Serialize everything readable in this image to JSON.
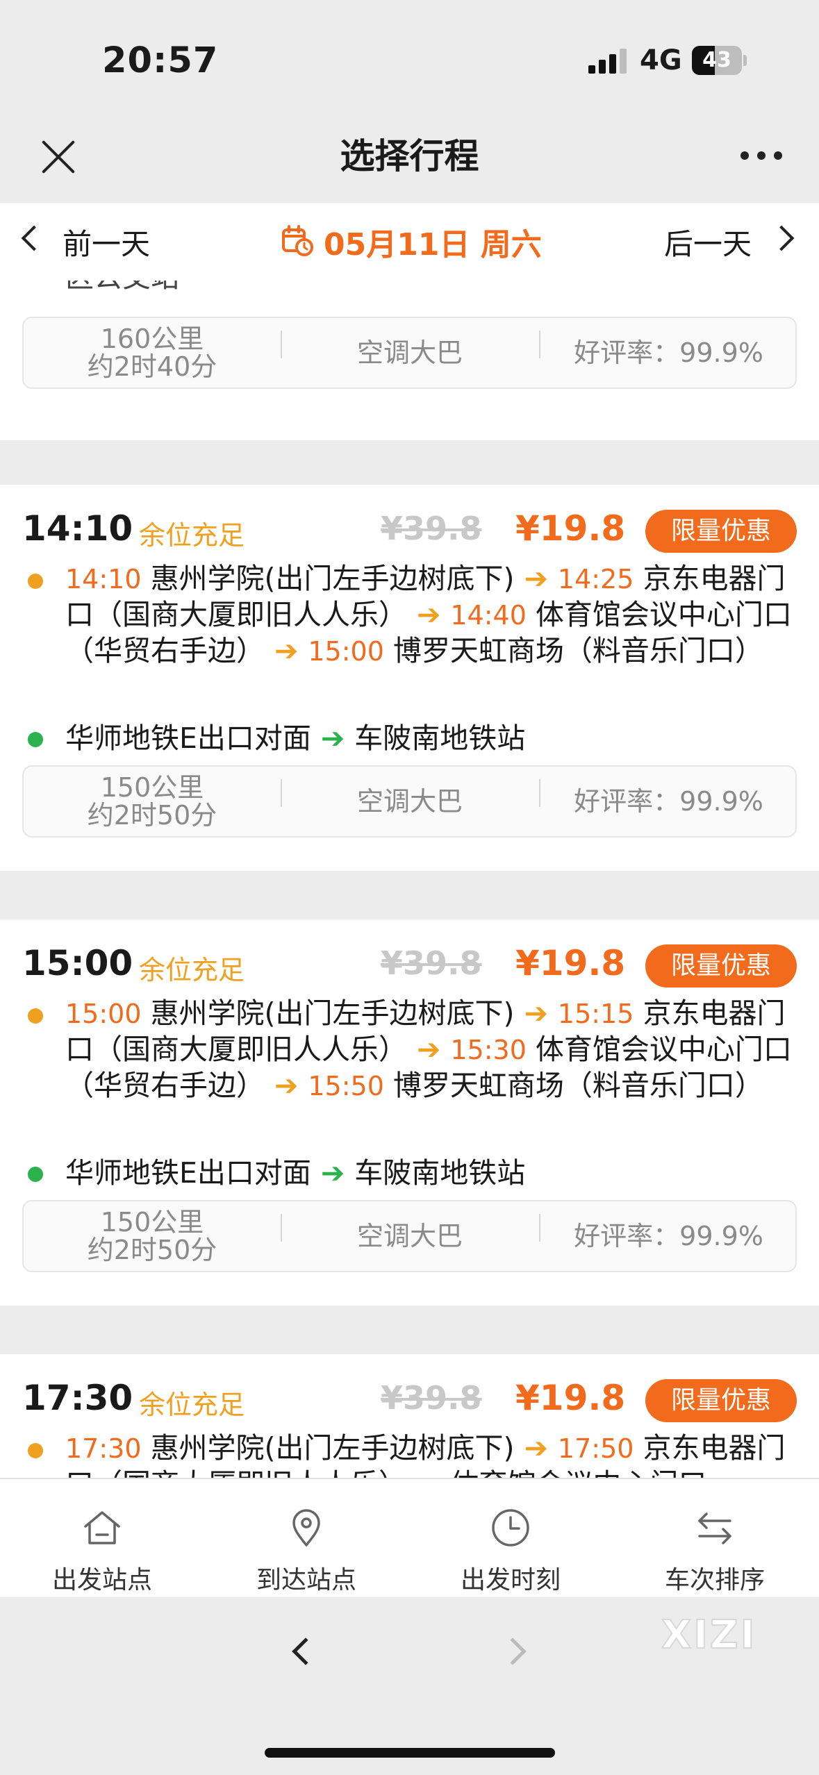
{
  "status": {
    "time": "20:57",
    "network": "4G",
    "battery": "43"
  },
  "nav": {
    "title": "选择行程",
    "close_icon": "close-icon",
    "more_icon": "more-icon"
  },
  "date_bar": {
    "prev": "前一天",
    "date": "05月11日 周六",
    "next": "后一天",
    "icon": "calendar-icon"
  },
  "partial_top": {
    "cut_text": "区公交站",
    "info": {
      "distance": "160公里",
      "duration": "约2时40分",
      "bus": "空调大巴",
      "rating": "好评率：99.9%"
    }
  },
  "trips": [
    {
      "time": "14:10",
      "seat": "余位充足",
      "old_price": "¥39.8",
      "price": "¥19.8",
      "promo": "限量优惠",
      "stops": [
        {
          "t": "14:10",
          "name": "惠州学院(出门左手边树底下)"
        },
        {
          "t": "14:25",
          "name": "京东电器门口（国商大厦即旧人人乐）"
        },
        {
          "t": "14:40",
          "name": "体育馆会议中心门口（华贸右手边）"
        },
        {
          "t": "15:00",
          "name": "博罗天虹商场（料音乐门口）"
        }
      ],
      "from": "华师地铁E出口对面",
      "to": "车陂南地铁站",
      "info": {
        "distance": "150公里",
        "duration": "约2时50分",
        "bus": "空调大巴",
        "rating": "好评率：99.9%"
      }
    },
    {
      "time": "15:00",
      "seat": "余位充足",
      "old_price": "¥39.8",
      "price": "¥19.8",
      "promo": "限量优惠",
      "stops": [
        {
          "t": "15:00",
          "name": "惠州学院(出门左手边树底下)"
        },
        {
          "t": "15:15",
          "name": "京东电器门口（国商大厦即旧人人乐）"
        },
        {
          "t": "15:30",
          "name": "体育馆会议中心门口（华贸右手边）"
        },
        {
          "t": "15:50",
          "name": "博罗天虹商场（料音乐门口）"
        }
      ],
      "from": "华师地铁E出口对面",
      "to": "车陂南地铁站",
      "info": {
        "distance": "150公里",
        "duration": "约2时50分",
        "bus": "空调大巴",
        "rating": "好评率：99.9%"
      }
    },
    {
      "time": "17:30",
      "seat": "余位充足",
      "old_price": "¥39.8",
      "price": "¥19.8",
      "promo": "限量优惠",
      "stops": [
        {
          "t": "17:30",
          "name": "惠州学院(出门左手边树底下)"
        },
        {
          "t": "17:50",
          "name": "京东电器门口（国商大厦即旧人人乐）"
        },
        {
          "t": "",
          "name": "体育馆会议中心门口"
        }
      ]
    }
  ],
  "tabs": [
    {
      "label": "出发站点",
      "icon": "home-icon"
    },
    {
      "label": "到达站点",
      "icon": "location-pin-icon"
    },
    {
      "label": "出发时刻",
      "icon": "clock-icon"
    },
    {
      "label": "车次排序",
      "icon": "sort-arrows-icon"
    }
  ],
  "watermark": "XIZI",
  "colors": {
    "accent": "#f26a1b",
    "seat": "#f0a020",
    "green": "#2bb24c"
  }
}
